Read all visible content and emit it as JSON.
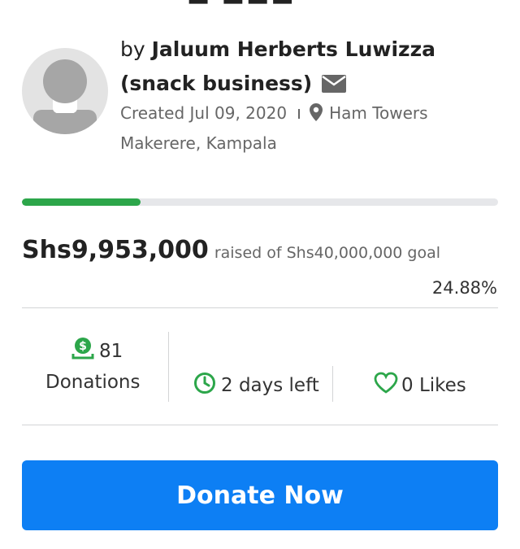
{
  "campaign": {
    "by_label": "by",
    "owner_name": "Jaluum Herberts Luwizza (snack business)",
    "created": "Created Jul 09, 2020",
    "location": "Ham Towers Makerere, Kampala"
  },
  "progress": {
    "fraction": 0.2488,
    "raised_amount": "Shs9,953,000",
    "goal_text": "raised of Shs40,000,000 goal",
    "percent_text": "24.88%"
  },
  "stats": {
    "donations_count": "81",
    "donations_label": "Donations",
    "days_left": "2 days left",
    "likes": "0 Likes"
  },
  "donate_button": {
    "label": "Donate Now"
  },
  "colors": {
    "accent": "#0d7ff4",
    "progress": "#2ca64a",
    "success": "#2ca64a"
  },
  "icons": {
    "mail": "envelope-icon",
    "location": "map-pin-icon",
    "donation": "money-hand-icon",
    "time": "clock-icon",
    "like": "heart-icon"
  }
}
